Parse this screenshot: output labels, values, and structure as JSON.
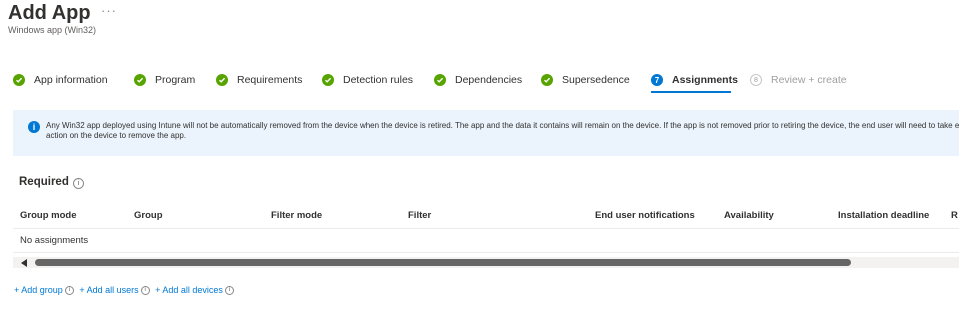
{
  "header": {
    "title": "Add App",
    "more_label": "···",
    "subtitle": "Windows app (Win32)"
  },
  "steps": [
    {
      "label": "App information",
      "state": "done"
    },
    {
      "label": "Program",
      "state": "done"
    },
    {
      "label": "Requirements",
      "state": "done"
    },
    {
      "label": "Detection rules",
      "state": "done"
    },
    {
      "label": "Dependencies",
      "state": "done"
    },
    {
      "label": "Supersedence",
      "state": "done"
    },
    {
      "label": "Assignments",
      "state": "current",
      "number": "7"
    },
    {
      "label": "Review + create",
      "state": "future",
      "number": "8"
    }
  ],
  "info": {
    "text": "Any Win32 app deployed using Intune will not be automatically removed from the device when the device is retired. The app and the data it contains will remain on the device. If the app is not removed prior to retiring the device, the end user will need to take explicit action on the device to remove the app."
  },
  "required": {
    "title": "Required",
    "columns": [
      "Group mode",
      "Group",
      "Filter mode",
      "Filter",
      "End user notifications",
      "Availability",
      "Installation deadline",
      "R"
    ],
    "empty_text": "No assignments"
  },
  "actions": {
    "add_group": "+ Add group",
    "add_all_users": "+ Add all users",
    "add_all_devices": "+ Add all devices"
  },
  "colors": {
    "accent": "#0078d4",
    "done": "#57a300",
    "info_bg": "#ebf3fc"
  }
}
